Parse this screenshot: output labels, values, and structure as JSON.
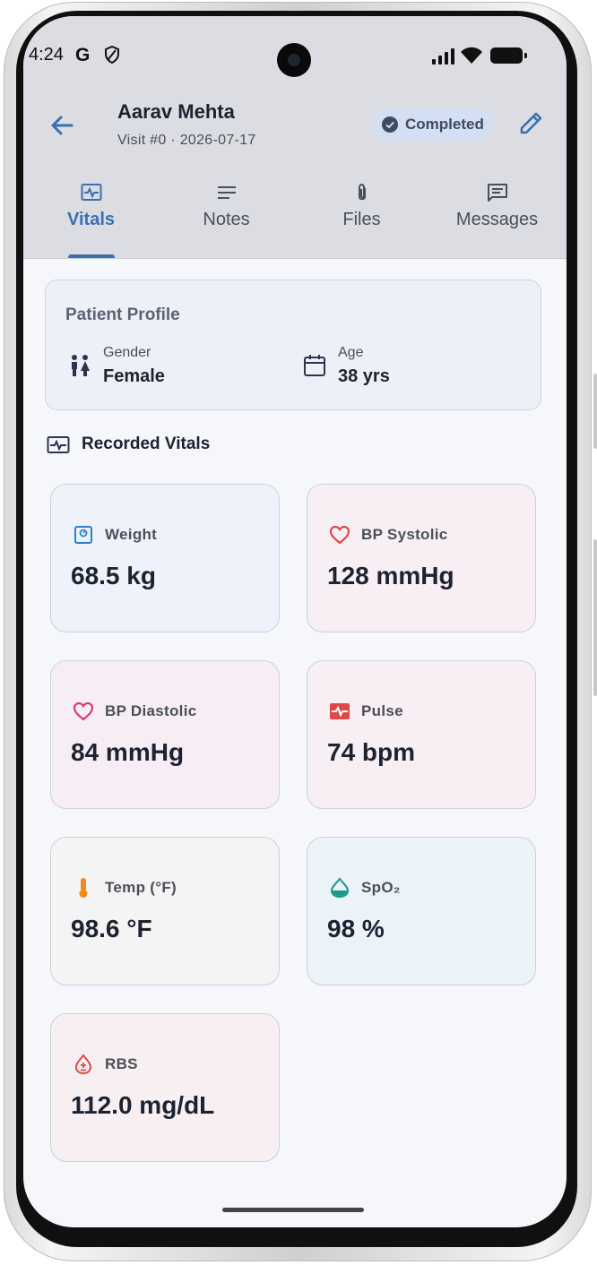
{
  "status_bar": {
    "time": "4:24",
    "g_letter": "G"
  },
  "header": {
    "patient_name": "Aarav Mehta",
    "visit_line": "Visit #0 · 2026-07-17",
    "status_badge": "Completed"
  },
  "tabs": [
    {
      "label": "Vitals",
      "icon": "vitals-icon",
      "active": true
    },
    {
      "label": "Notes",
      "icon": "notes-icon",
      "active": false
    },
    {
      "label": "Files",
      "icon": "paperclip-icon",
      "active": false
    },
    {
      "label": "Messages",
      "icon": "message-icon",
      "active": false
    }
  ],
  "profile": {
    "title": "Patient Profile",
    "gender_label": "Gender",
    "gender_value": "Female",
    "age_label": "Age",
    "age_value": "38 yrs"
  },
  "vitals_section": {
    "title": "Recorded Vitals"
  },
  "vitals": [
    {
      "label": "Weight",
      "value": "68.5 kg",
      "icon": "scale-icon",
      "bg": "#eef3fb",
      "icon_color": "#2f7fd0"
    },
    {
      "label": "BP Systolic",
      "value": "128 mmHg",
      "icon": "heart-outline-icon",
      "bg": "#f7eff3",
      "icon_color": "#e04848"
    },
    {
      "label": "BP Diastolic",
      "value": "84 mmHg",
      "icon": "heart-outline-icon",
      "bg": "#f7eef5",
      "icon_color": "#d63a78"
    },
    {
      "label": "Pulse",
      "value": "74 bpm",
      "icon": "pulse-icon",
      "bg": "#f7eff4",
      "icon_color": "#e04848"
    },
    {
      "label": "Temp (°F)",
      "value": "98.6 °F",
      "icon": "thermometer-icon",
      "bg": "#f5f4f4",
      "icon_color": "#f08a1a"
    },
    {
      "label": "SpO₂",
      "value": "98 %",
      "icon": "drop-icon",
      "bg": "#ebf2f8",
      "icon_color": "#1a9a8a"
    },
    {
      "label": "RBS",
      "value": "112.0 mg/dL",
      "icon": "blood-drop-icon",
      "bg": "#f7eff2",
      "icon_color": "#e04848"
    }
  ],
  "colors": {
    "accent": "#3a6fb5",
    "header_bg": "#dcdde3",
    "screen_bg": "#f6f7fb"
  }
}
